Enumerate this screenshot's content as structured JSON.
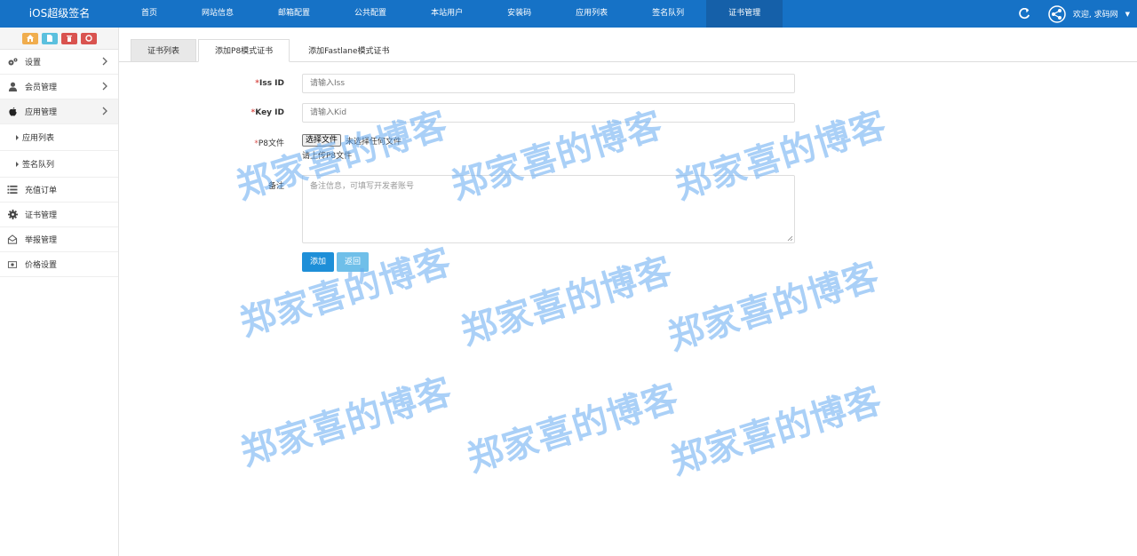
{
  "app": {
    "title": "iOS超级签名"
  },
  "nav": {
    "items": [
      {
        "label": "首页"
      },
      {
        "label": "网站信息"
      },
      {
        "label": "邮箱配置"
      },
      {
        "label": "公共配置"
      },
      {
        "label": "本站用户"
      },
      {
        "label": "安装码"
      },
      {
        "label": "应用列表"
      },
      {
        "label": "签名队列"
      },
      {
        "label": "证书管理",
        "active": true
      }
    ],
    "user_greeting": "欢迎, 求码网"
  },
  "sidebar": {
    "shortcut_colors": [
      "#f0ad4e",
      "#5bc0de",
      "#d9534f",
      "#d9534f"
    ],
    "items": [
      {
        "label": "设置",
        "icon": "gears-icon"
      },
      {
        "label": "会员管理",
        "icon": "user-icon"
      },
      {
        "label": "应用管理",
        "icon": "apple-icon",
        "active": true
      },
      {
        "label": "应用列表",
        "sub": true
      },
      {
        "label": "签名队列",
        "sub": true
      },
      {
        "label": "充值订单",
        "icon": "list-icon"
      },
      {
        "label": "证书管理",
        "icon": "gear-icon"
      },
      {
        "label": "举报管理",
        "icon": "envelope-icon"
      },
      {
        "label": "价格设置",
        "icon": "money-icon"
      }
    ]
  },
  "tabs": [
    {
      "label": "证书列表"
    },
    {
      "label": "添加P8模式证书",
      "active": true
    },
    {
      "label": "添加Fastlane模式证书"
    }
  ],
  "form": {
    "iss": {
      "label": "Iss ID",
      "required_mark": "*",
      "placeholder": "请输入Iss"
    },
    "kid": {
      "label": "Key ID",
      "required_mark": "*",
      "placeholder": "请输入Kid"
    },
    "p8": {
      "label": "P8文件",
      "required_mark": "*",
      "button": "选择文件",
      "status": "未选择任何文件",
      "hint": "请上传P8文件"
    },
    "remark": {
      "label": "备注",
      "placeholder": "备注信息，可填写开发者账号"
    },
    "add_button": "添加",
    "back_button": "返回"
  },
  "watermark": {
    "text": "郑家喜的博客"
  },
  "colors": {
    "topbar": "#1672c6",
    "primary_button": "#1e8fd8",
    "required": "#d9534f"
  }
}
